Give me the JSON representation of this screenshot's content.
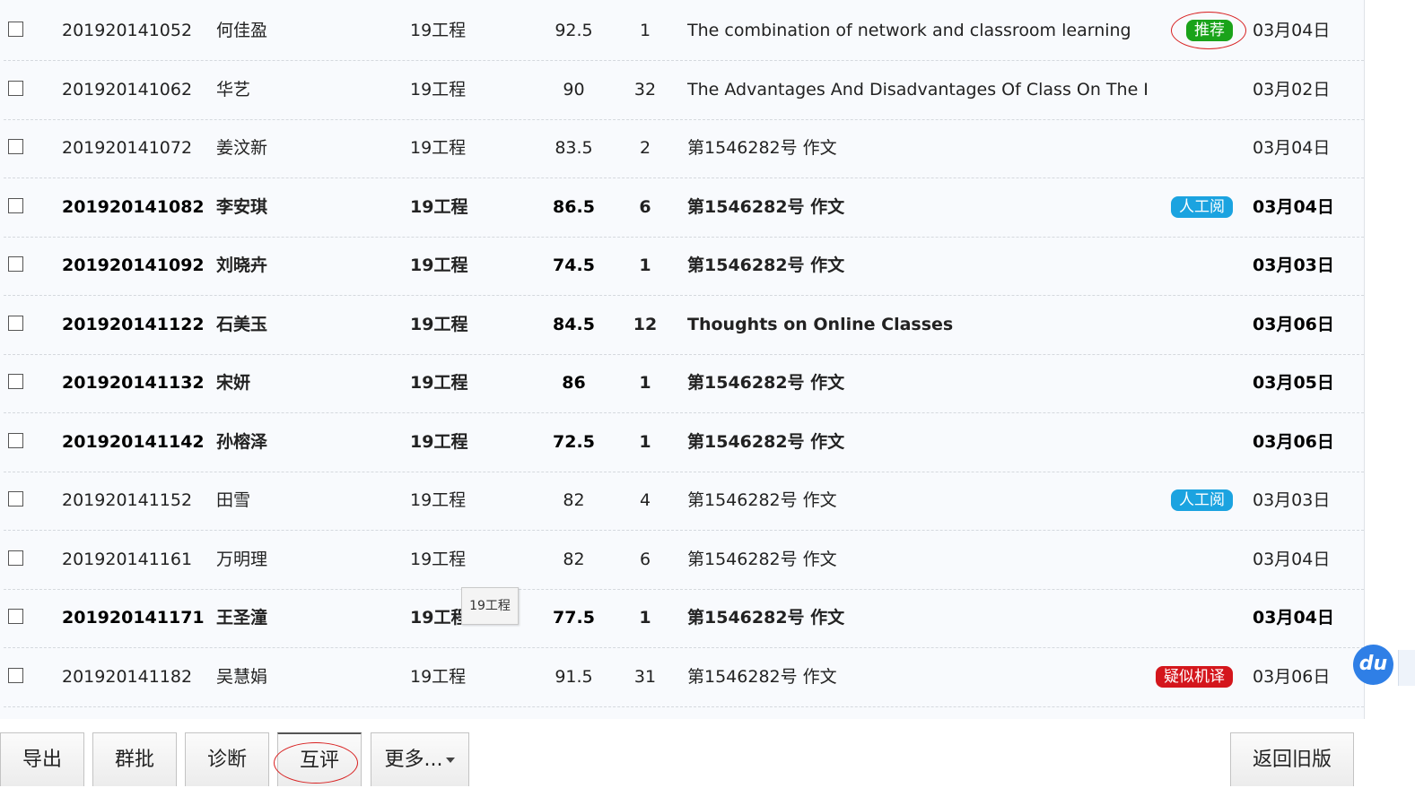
{
  "rows": [
    {
      "id": "201920141052",
      "name": "何佳盈",
      "class": "19工程",
      "score": "92.5",
      "count": "1",
      "title": "The combination of network and classroom learning",
      "badge": "推荐",
      "badge_color": "#1aa31a",
      "date": "03月04日",
      "bold": false
    },
    {
      "id": "201920141062",
      "name": "华艺",
      "class": "19工程",
      "score": "90",
      "count": "32",
      "title": "The Advantages And Disadvantages Of Class On The I",
      "badge": "",
      "badge_color": "",
      "date": "03月02日",
      "bold": false
    },
    {
      "id": "201920141072",
      "name": "姜汶新",
      "class": "19工程",
      "score": "83.5",
      "count": "2",
      "title": "第1546282号 作文",
      "badge": "",
      "badge_color": "",
      "date": "03月04日",
      "bold": false
    },
    {
      "id": "201920141082",
      "name": "李安琪",
      "class": "19工程",
      "score": "86.5",
      "count": "6",
      "title": "第1546282号 作文",
      "badge": "人工阅",
      "badge_color": "#1ba3e0",
      "date": "03月04日",
      "bold": true
    },
    {
      "id": "201920141092",
      "name": "刘晓卉",
      "class": "19工程",
      "score": "74.5",
      "count": "1",
      "title": "第1546282号 作文",
      "badge": "",
      "badge_color": "",
      "date": "03月03日",
      "bold": true
    },
    {
      "id": "201920141122",
      "name": "石美玉",
      "class": "19工程",
      "score": "84.5",
      "count": "12",
      "title": "Thoughts on Online Classes",
      "badge": "",
      "badge_color": "",
      "date": "03月06日",
      "bold": true
    },
    {
      "id": "201920141132",
      "name": "宋妍",
      "class": "19工程",
      "score": "86",
      "count": "1",
      "title": "第1546282号 作文",
      "badge": "",
      "badge_color": "",
      "date": "03月05日",
      "bold": true
    },
    {
      "id": "201920141142",
      "name": "孙榕泽",
      "class": "19工程",
      "score": "72.5",
      "count": "1",
      "title": "第1546282号 作文",
      "badge": "",
      "badge_color": "",
      "date": "03月06日",
      "bold": true
    },
    {
      "id": "201920141152",
      "name": "田雪",
      "class": "19工程",
      "score": "82",
      "count": "4",
      "title": "第1546282号 作文",
      "badge": "人工阅",
      "badge_color": "#1ba3e0",
      "date": "03月03日",
      "bold": false
    },
    {
      "id": "201920141161",
      "name": "万明理",
      "class": "19工程",
      "score": "82",
      "count": "6",
      "title": "第1546282号 作文",
      "badge": "",
      "badge_color": "",
      "date": "03月04日",
      "bold": false
    },
    {
      "id": "201920141171",
      "name": "王圣潼",
      "class": "19工程",
      "score": "77.5",
      "count": "1",
      "title": "第1546282号 作文",
      "badge": "",
      "badge_color": "",
      "date": "03月04日",
      "bold": true
    },
    {
      "id": "201920141182",
      "name": "吴慧娟",
      "class": "19工程",
      "score": "91.5",
      "count": "31",
      "title": "第1546282号 作文",
      "badge": "疑似机译",
      "badge_color": "#d4161c",
      "date": "03月06日",
      "bold": false
    }
  ],
  "tooltip": {
    "text": "19工程"
  },
  "toolbar": {
    "export_label": "导出",
    "batch_label": "群批",
    "diagnose_label": "诊断",
    "peer_review_label": "互评",
    "more_label": "更多...",
    "old_version_label": "返回旧版"
  },
  "float_button": {
    "label": "du",
    "icon": "du-assistant-icon"
  },
  "colors": {
    "link": "#2f7fc4",
    "recommend": "#1aa31a",
    "manual": "#1ba3e0",
    "machine": "#d4161c",
    "annotation": "#d82020"
  }
}
